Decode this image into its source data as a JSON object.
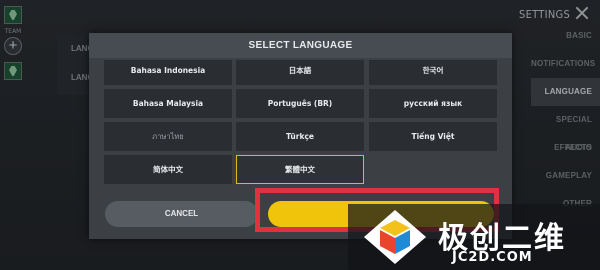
{
  "background": {
    "team_label": "TEAM",
    "team_add_symbol": "+",
    "left_panel_label_1": "LANGU",
    "left_panel_label_2": "LANGU",
    "settings_title": "SETTINGS",
    "close_icon": "close-icon",
    "side_nav": [
      {
        "label": "BASIC",
        "active": false
      },
      {
        "label": "NOTIFICATIONS",
        "active": false
      },
      {
        "label": "LANGUAGE",
        "active": true
      },
      {
        "label": "SPECIAL EFFECTS",
        "active": false
      },
      {
        "label": "AUDIO",
        "active": false
      },
      {
        "label": "GAMEPLAY",
        "active": false
      },
      {
        "label": "OTHER",
        "active": false
      }
    ]
  },
  "dialog": {
    "title": "SELECT LANGUAGE",
    "languages": [
      "Bahasa Indonesia",
      "日本語",
      "한국어",
      "Bahasa Malaysia",
      "Português (BR)",
      "русский язык",
      "ภาษาไทย",
      "Türkçe",
      "Tiếng Việt",
      "简体中文",
      "繁體中文"
    ],
    "selected_language": "繁體中文",
    "cancel_label": "CANCEL",
    "confirm_label": "",
    "accent_color": "#f1c40c",
    "highlight_color": "#e0313f"
  },
  "watermark": {
    "chinese": "极创二维",
    "english": "JC2D.COM"
  }
}
